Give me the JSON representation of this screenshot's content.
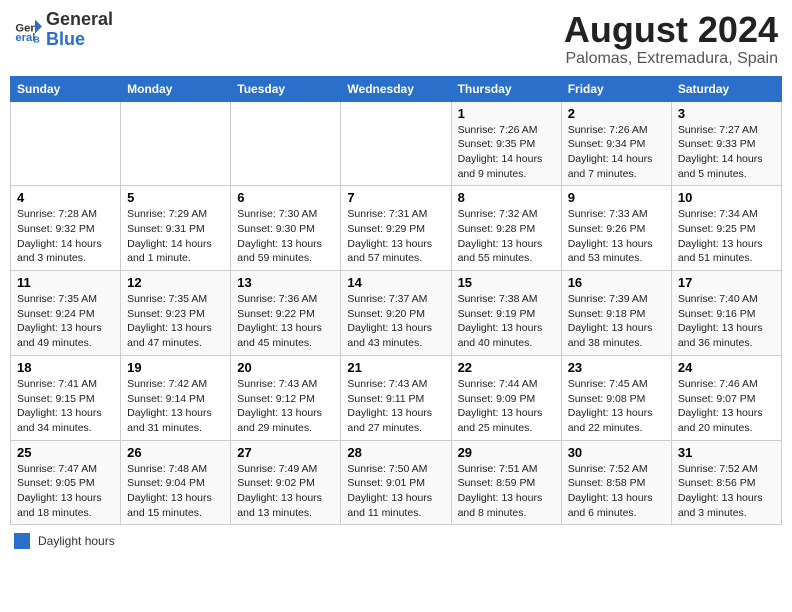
{
  "header": {
    "logo_general": "General",
    "logo_blue": "Blue",
    "title": "August 2024",
    "subtitle": "Palomas, Extremadura, Spain"
  },
  "days_of_week": [
    "Sunday",
    "Monday",
    "Tuesday",
    "Wednesday",
    "Thursday",
    "Friday",
    "Saturday"
  ],
  "legend": {
    "label": "Daylight hours"
  },
  "weeks": [
    {
      "days": [
        {
          "num": "",
          "info": ""
        },
        {
          "num": "",
          "info": ""
        },
        {
          "num": "",
          "info": ""
        },
        {
          "num": "",
          "info": ""
        },
        {
          "num": "1",
          "info": "Sunrise: 7:26 AM\nSunset: 9:35 PM\nDaylight: 14 hours and 9 minutes."
        },
        {
          "num": "2",
          "info": "Sunrise: 7:26 AM\nSunset: 9:34 PM\nDaylight: 14 hours and 7 minutes."
        },
        {
          "num": "3",
          "info": "Sunrise: 7:27 AM\nSunset: 9:33 PM\nDaylight: 14 hours and 5 minutes."
        }
      ]
    },
    {
      "days": [
        {
          "num": "4",
          "info": "Sunrise: 7:28 AM\nSunset: 9:32 PM\nDaylight: 14 hours and 3 minutes."
        },
        {
          "num": "5",
          "info": "Sunrise: 7:29 AM\nSunset: 9:31 PM\nDaylight: 14 hours and 1 minute."
        },
        {
          "num": "6",
          "info": "Sunrise: 7:30 AM\nSunset: 9:30 PM\nDaylight: 13 hours and 59 minutes."
        },
        {
          "num": "7",
          "info": "Sunrise: 7:31 AM\nSunset: 9:29 PM\nDaylight: 13 hours and 57 minutes."
        },
        {
          "num": "8",
          "info": "Sunrise: 7:32 AM\nSunset: 9:28 PM\nDaylight: 13 hours and 55 minutes."
        },
        {
          "num": "9",
          "info": "Sunrise: 7:33 AM\nSunset: 9:26 PM\nDaylight: 13 hours and 53 minutes."
        },
        {
          "num": "10",
          "info": "Sunrise: 7:34 AM\nSunset: 9:25 PM\nDaylight: 13 hours and 51 minutes."
        }
      ]
    },
    {
      "days": [
        {
          "num": "11",
          "info": "Sunrise: 7:35 AM\nSunset: 9:24 PM\nDaylight: 13 hours and 49 minutes."
        },
        {
          "num": "12",
          "info": "Sunrise: 7:35 AM\nSunset: 9:23 PM\nDaylight: 13 hours and 47 minutes."
        },
        {
          "num": "13",
          "info": "Sunrise: 7:36 AM\nSunset: 9:22 PM\nDaylight: 13 hours and 45 minutes."
        },
        {
          "num": "14",
          "info": "Sunrise: 7:37 AM\nSunset: 9:20 PM\nDaylight: 13 hours and 43 minutes."
        },
        {
          "num": "15",
          "info": "Sunrise: 7:38 AM\nSunset: 9:19 PM\nDaylight: 13 hours and 40 minutes."
        },
        {
          "num": "16",
          "info": "Sunrise: 7:39 AM\nSunset: 9:18 PM\nDaylight: 13 hours and 38 minutes."
        },
        {
          "num": "17",
          "info": "Sunrise: 7:40 AM\nSunset: 9:16 PM\nDaylight: 13 hours and 36 minutes."
        }
      ]
    },
    {
      "days": [
        {
          "num": "18",
          "info": "Sunrise: 7:41 AM\nSunset: 9:15 PM\nDaylight: 13 hours and 34 minutes."
        },
        {
          "num": "19",
          "info": "Sunrise: 7:42 AM\nSunset: 9:14 PM\nDaylight: 13 hours and 31 minutes."
        },
        {
          "num": "20",
          "info": "Sunrise: 7:43 AM\nSunset: 9:12 PM\nDaylight: 13 hours and 29 minutes."
        },
        {
          "num": "21",
          "info": "Sunrise: 7:43 AM\nSunset: 9:11 PM\nDaylight: 13 hours and 27 minutes."
        },
        {
          "num": "22",
          "info": "Sunrise: 7:44 AM\nSunset: 9:09 PM\nDaylight: 13 hours and 25 minutes."
        },
        {
          "num": "23",
          "info": "Sunrise: 7:45 AM\nSunset: 9:08 PM\nDaylight: 13 hours and 22 minutes."
        },
        {
          "num": "24",
          "info": "Sunrise: 7:46 AM\nSunset: 9:07 PM\nDaylight: 13 hours and 20 minutes."
        }
      ]
    },
    {
      "days": [
        {
          "num": "25",
          "info": "Sunrise: 7:47 AM\nSunset: 9:05 PM\nDaylight: 13 hours and 18 minutes."
        },
        {
          "num": "26",
          "info": "Sunrise: 7:48 AM\nSunset: 9:04 PM\nDaylight: 13 hours and 15 minutes."
        },
        {
          "num": "27",
          "info": "Sunrise: 7:49 AM\nSunset: 9:02 PM\nDaylight: 13 hours and 13 minutes."
        },
        {
          "num": "28",
          "info": "Sunrise: 7:50 AM\nSunset: 9:01 PM\nDaylight: 13 hours and 11 minutes."
        },
        {
          "num": "29",
          "info": "Sunrise: 7:51 AM\nSunset: 8:59 PM\nDaylight: 13 hours and 8 minutes."
        },
        {
          "num": "30",
          "info": "Sunrise: 7:52 AM\nSunset: 8:58 PM\nDaylight: 13 hours and 6 minutes."
        },
        {
          "num": "31",
          "info": "Sunrise: 7:52 AM\nSunset: 8:56 PM\nDaylight: 13 hours and 3 minutes."
        }
      ]
    }
  ]
}
